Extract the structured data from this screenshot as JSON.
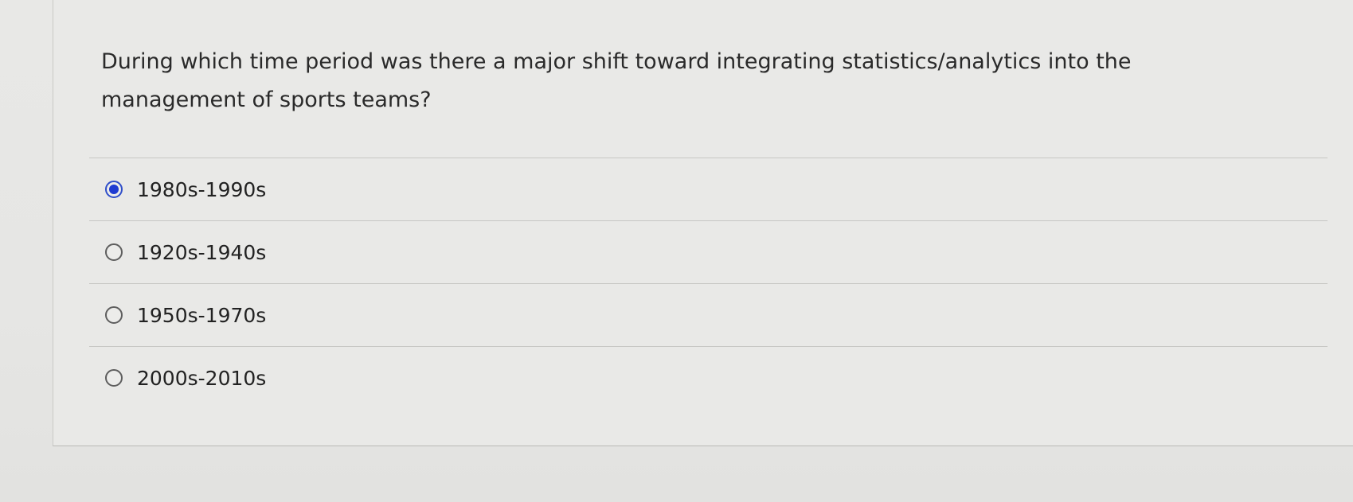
{
  "question": {
    "text": "During which time period was there a major shift toward integrating statistics/analytics into the management of sports teams?"
  },
  "options": [
    {
      "label": "1980s-1990s",
      "selected": true
    },
    {
      "label": "1920s-1940s",
      "selected": false
    },
    {
      "label": "1950s-1970s",
      "selected": false
    },
    {
      "label": "2000s-2010s",
      "selected": false
    }
  ],
  "colors": {
    "selected_radio": "#1f3bd1",
    "text": "#222222",
    "background": "#e8e8e6"
  }
}
